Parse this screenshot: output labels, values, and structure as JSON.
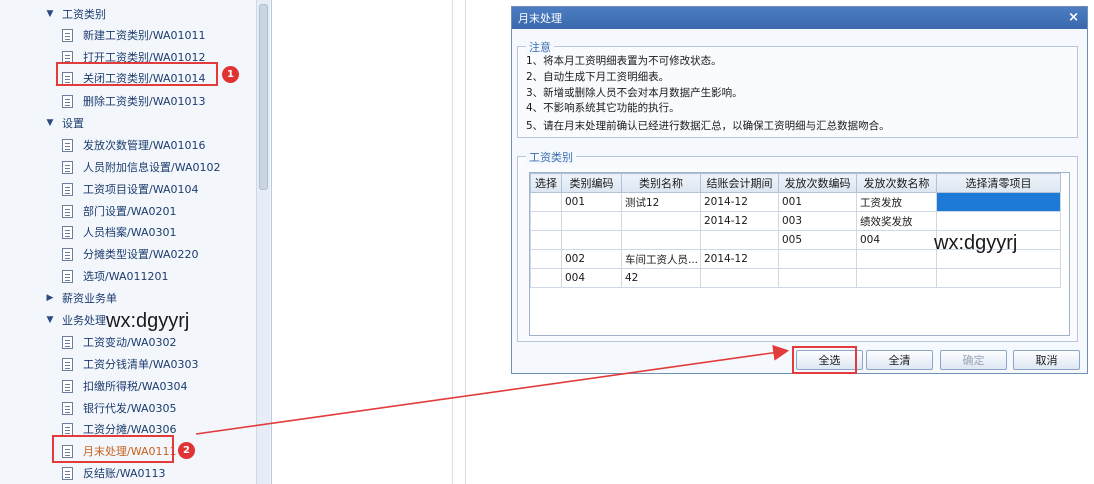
{
  "tree": {
    "groups": [
      {
        "label": "工资类别",
        "expanded": true
      },
      {
        "label": "设置",
        "expanded": true
      },
      {
        "label": "薪资业务单",
        "expanded": false
      },
      {
        "label": "业务处理",
        "expanded": true
      }
    ],
    "items": [
      "新建工资类别/WA01011",
      "打开工资类别/WA01012",
      "关闭工资类别/WA01014",
      "删除工资类别/WA01013",
      "发放次数管理/WA01016",
      "人员附加信息设置/WA0102",
      "工资项目设置/WA0104",
      "部门设置/WA0201",
      "人员档案/WA0301",
      "分摊类型设置/WA0220",
      "选项/WA011201",
      "工资变动/WA0302",
      "工资分钱清单/WA0303",
      "扣缴所得税/WA0304",
      "银行代发/WA0305",
      "工资分摊/WA0306",
      "月末处理/WA0111",
      "反结账/WA0113"
    ]
  },
  "badges": [
    "1",
    "2"
  ],
  "watermark": "wx:dgyyrj",
  "dialog": {
    "title": "月末处理",
    "close": "×",
    "notes_legend": "注意",
    "notes": [
      "1、将本月工资明细表置为不可修改状态。",
      "2、自动生成下月工资明细表。",
      "3、新增或删除人员不会对本月数据产生影响。",
      "4、不影响系统其它功能的执行。",
      "5、请在月末处理前确认已经进行数据汇总，以确保工资明细与汇总数据吻合。"
    ],
    "category_legend": "工资类别",
    "columns": [
      "选择",
      "类别编码",
      "类别名称",
      "结账会计期间",
      "发放次数编码",
      "发放次数名称",
      "选择清零项目"
    ],
    "rows": [
      [
        "",
        "001",
        "测试12",
        "2014-12",
        "001",
        "工资发放",
        ""
      ],
      [
        "",
        "",
        "",
        "2014-12",
        "003",
        "绩效奖发放",
        ""
      ],
      [
        "",
        "",
        "",
        "",
        "005",
        "004",
        ""
      ],
      [
        "",
        "002",
        "车间工资人员...",
        "2014-12",
        "",
        "",
        ""
      ],
      [
        "",
        "004",
        "42",
        "",
        "",
        "",
        ""
      ]
    ],
    "buttons": {
      "select_all": "全选",
      "clear_all": "全清",
      "ok": "确定",
      "cancel": "取消"
    }
  },
  "colors": {
    "annotation_red": "#e23b3b",
    "title_bar": "#3f6fb4",
    "selected_cell": "#1e78d6"
  }
}
